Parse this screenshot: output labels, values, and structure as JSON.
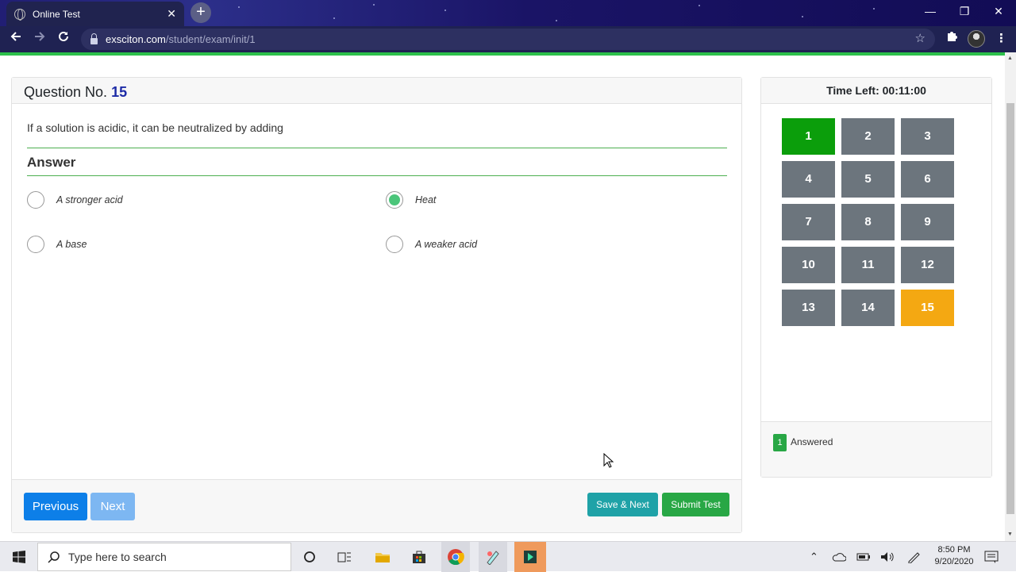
{
  "browser": {
    "tab_title": "Online Test",
    "tab_close": "✕",
    "new_tab": "+",
    "url_host": "exsciton.com",
    "url_path": "/student/exam/init/1",
    "window_controls": {
      "minimize": "—",
      "restore": "❐",
      "close": "✕"
    }
  },
  "question": {
    "label": "Question No.",
    "number": "15",
    "text": "If a solution is acidic, it can be neutralized by adding",
    "answer_heading": "Answer",
    "options": [
      {
        "label": "A stronger acid",
        "selected": false
      },
      {
        "label": "Heat",
        "selected": true
      },
      {
        "label": "A base",
        "selected": false
      },
      {
        "label": "A weaker acid",
        "selected": false
      }
    ]
  },
  "footer": {
    "previous": "Previous",
    "next": "Next",
    "save_next": "Save & Next",
    "submit": "Submit Test"
  },
  "sidebar": {
    "timer": "Time Left: 00:11:00",
    "questions": [
      "1",
      "2",
      "3",
      "4",
      "5",
      "6",
      "7",
      "8",
      "9",
      "10",
      "11",
      "12",
      "13",
      "14",
      "15"
    ],
    "answered": [
      "1"
    ],
    "current": "15",
    "legend_count": "1",
    "legend_label": "Answered"
  },
  "colors": {
    "answered": "#0b9e0b",
    "current": "#f4a812",
    "unanswered": "#6c757d",
    "primary": "#0d7fe8",
    "teal": "#1fa2a7",
    "success": "#28a745"
  },
  "taskbar": {
    "search_placeholder": "Type here to search",
    "time": "8:50 PM",
    "date": "9/20/2020"
  }
}
